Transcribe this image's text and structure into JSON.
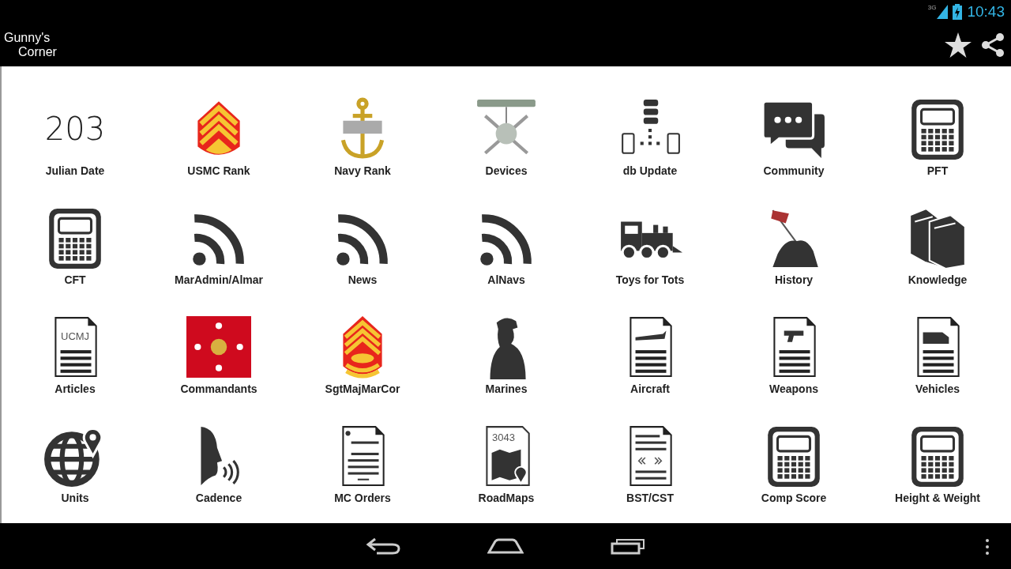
{
  "status_bar": {
    "network": "3G",
    "time": "10:43"
  },
  "action_bar": {
    "title_lines": [
      "Gunny's",
      "Corner"
    ]
  },
  "tiles": [
    {
      "label": "Julian Date",
      "kind": "number",
      "icon_text": "203"
    },
    {
      "label": "USMC Rank",
      "kind": "chevron"
    },
    {
      "label": "Navy Rank",
      "kind": "anchor"
    },
    {
      "label": "Devices",
      "kind": "badge"
    },
    {
      "label": "db Update",
      "kind": "sync"
    },
    {
      "label": "Community",
      "kind": "chat"
    },
    {
      "label": "PFT",
      "kind": "calculator"
    },
    {
      "label": "CFT",
      "kind": "calculator"
    },
    {
      "label": "MarAdmin/Almar",
      "kind": "rss"
    },
    {
      "label": "News",
      "kind": "rss"
    },
    {
      "label": "AlNavs",
      "kind": "rss"
    },
    {
      "label": "Toys for Tots",
      "kind": "train"
    },
    {
      "label": "History",
      "kind": "flag-raising"
    },
    {
      "label": "Knowledge",
      "kind": "books"
    },
    {
      "label": "Articles",
      "kind": "doc-text",
      "icon_text": "UCMJ"
    },
    {
      "label": "Commandants",
      "kind": "flag"
    },
    {
      "label": "SgtMajMarCor",
      "kind": "chevron-major"
    },
    {
      "label": "Marines",
      "kind": "silhouette"
    },
    {
      "label": "Aircraft",
      "kind": "doc-plane"
    },
    {
      "label": "Weapons",
      "kind": "doc-gun"
    },
    {
      "label": "Vehicles",
      "kind": "doc-truck"
    },
    {
      "label": "Units",
      "kind": "globe"
    },
    {
      "label": "Cadence",
      "kind": "voice"
    },
    {
      "label": "MC Orders",
      "kind": "doc-orders"
    },
    {
      "label": "RoadMaps",
      "kind": "map",
      "icon_text": "3043"
    },
    {
      "label": "BST/CST",
      "kind": "doc-arrows"
    },
    {
      "label": "Comp Score",
      "kind": "calculator"
    },
    {
      "label": "Height & Weight",
      "kind": "calculator"
    }
  ]
}
